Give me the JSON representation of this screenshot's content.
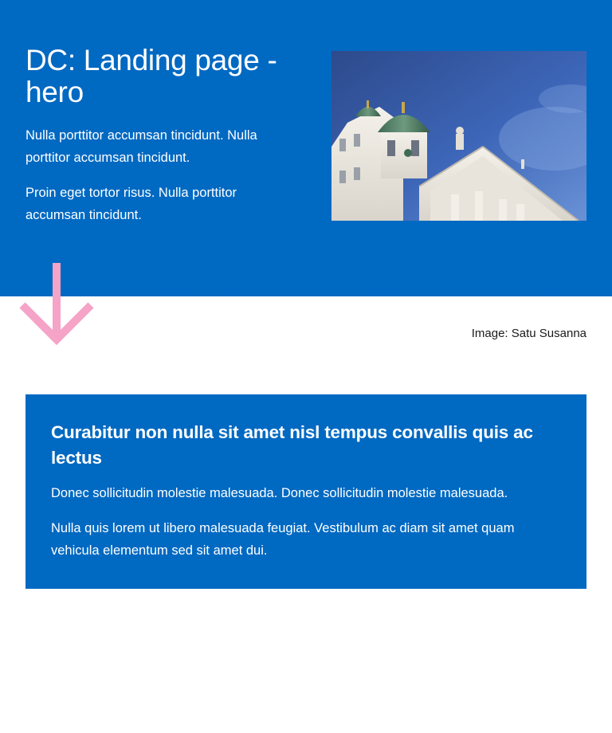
{
  "hero": {
    "title": "DC: Landing page - hero",
    "paragraphs": [
      "Nulla porttitor accumsan tincidunt. Nulla porttitor accumsan tincidunt.",
      "Proin eget tortor risus. Nulla porttitor accumsan tincidunt."
    ],
    "image_icon": "cathedral-photo-icon",
    "image_caption": "Image: Satu Susanna"
  },
  "decor": {
    "arrow_icon": "arrow-down-icon",
    "arrow_color": "#f5a3c7",
    "wave_color": "#0069c2"
  },
  "content": {
    "title": "Curabitur non nulla sit amet nisl tempus convallis quis ac lectus",
    "paragraphs": [
      "Donec sollicitudin molestie malesuada. Donec sollicitudin molestie malesuada.",
      "Nulla quis lorem ut libero malesuada feugiat. Vestibulum ac diam sit amet quam vehicula elementum sed sit amet dui."
    ]
  },
  "colors": {
    "brand_blue": "#0069c2",
    "text_on_brand": "#ffffff",
    "caption_text": "#1a1a1a"
  }
}
